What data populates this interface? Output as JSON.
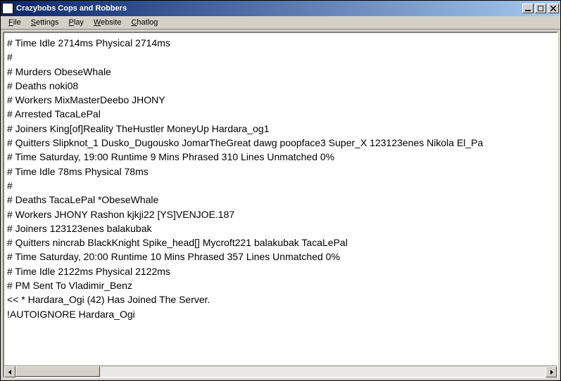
{
  "window": {
    "title": "Crazybobs Cops and Robbers"
  },
  "menubar": {
    "items": [
      {
        "label": "File",
        "underline": "F"
      },
      {
        "label": "Settings",
        "underline": "S"
      },
      {
        "label": "Play",
        "underline": "P"
      },
      {
        "label": "Website",
        "underline": "W"
      },
      {
        "label": "Chatlog",
        "underline": "C"
      }
    ]
  },
  "log": {
    "lines": [
      "# Time       Idle 2714ms Physical 2714ms",
      "#",
      "# Murders ObeseWhale",
      "# Deaths   noki08",
      "# Workers MixMasterDeebo JHONY",
      "# Arrested TacaLePal",
      "# Joiners   King[of]Reality TheHustler MoneyUp Hardara_og1",
      "# Quitters   Slipknot_1 Dusko_Dugousko JomarTheGreat dawg poopface3 Super_X 123123enes Nikola El_Pa",
      "# Time      Saturday, 19:00 Runtime 9 Mins Phrased 310 Lines Unmatched  0%",
      "# Time       Idle 78ms Physical 78ms",
      "#",
      "# Deaths   TacaLePal *ObeseWhale",
      "# Workers JHONY Rashon kjkji22 [YS]VENJOE.187",
      "# Joiners   123123enes balakubak",
      "# Quitters   nincrab BlackKnight Spike_head[] Mycroft221 balakubak TacaLePal",
      "# Time      Saturday, 20:00 Runtime 10 Mins Phrased 357 Lines Unmatched  0%",
      "# Time       Idle 2122ms Physical 2122ms",
      "# PM Sent To Vladimir_Benz",
      "<< * Hardara_Ogi (42) Has Joined The Server.",
      "  !AUTOIGNORE Hardara_Ogi"
    ]
  }
}
